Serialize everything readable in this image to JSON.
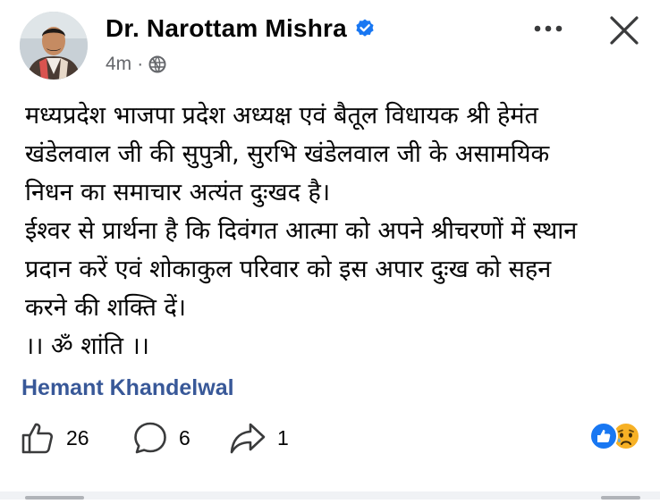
{
  "post": {
    "author": "Dr. Narottam Mishra",
    "time": "4m",
    "separator": "·",
    "body_lines": [
      "मध्यप्रदेश भाजपा प्रदेश अध्यक्ष एवं बैतूल विधायक श्री हेमंत",
      "खंडेलवाल जी की सुपुत्री, सुरभि खंडेलवाल जी के असामयिक",
      "निधन का समाचार अत्यंत दुःखद है।",
      "ईश्वर से प्रार्थना है कि दिवंगत आत्मा को अपने श्रीचरणों में स्थान",
      "प्रदान करें एवं शोकाकुल परिवार को इस अपार दुःख को सहन",
      "करने की शक्ति दें।",
      "।। ॐ शांति ।।"
    ],
    "tag": "Hemant Khandelwal"
  },
  "actions": {
    "likes": "26",
    "comments": "6",
    "shares": "1"
  },
  "icons": {
    "verified": "verified-badge-icon",
    "audience": "globe-icon",
    "more": "more-dots-icon",
    "close": "close-icon",
    "like": "thumbs-up-icon",
    "comment": "comment-bubble-icon",
    "share": "share-arrow-icon",
    "reaction_like": "like-reaction-icon",
    "reaction_sad": "sad-reaction-icon"
  },
  "colors": {
    "verified_blue": "#1877f2",
    "link_blue": "#385898",
    "secondary_text": "#65676b",
    "sad_yellow": "#f7b125"
  }
}
